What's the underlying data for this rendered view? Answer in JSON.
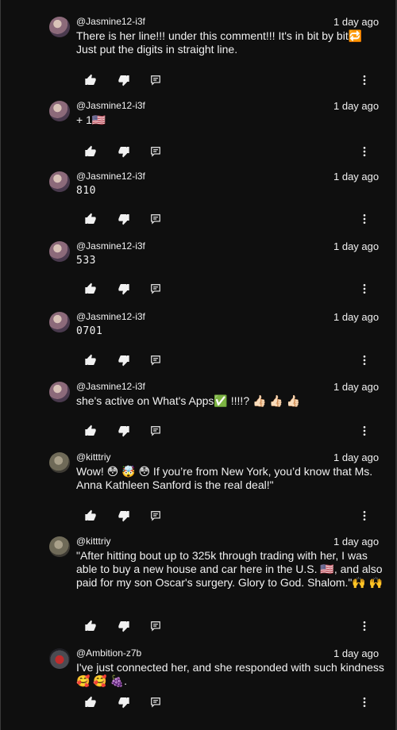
{
  "comments": [
    {
      "author": "@Jasmine12-i3f",
      "time": "1 day ago",
      "avatar": "jas",
      "text": "There is her line!!! under this comment!!! It's in bit by bit🔁\nJust put the digits in straight line.",
      "mono": false
    },
    {
      "author": "@Jasmine12-i3f",
      "time": "1 day ago",
      "avatar": "jas",
      "text": "+ 1🇺🇸",
      "mono": false
    },
    {
      "author": "@Jasmine12-i3f",
      "time": "1 day ago",
      "avatar": "jas",
      "text": "810",
      "mono": true
    },
    {
      "author": "@Jasmine12-i3f",
      "time": "1 day ago",
      "avatar": "jas",
      "text": "533",
      "mono": true
    },
    {
      "author": "@Jasmine12-i3f",
      "time": "1 day ago",
      "avatar": "jas",
      "text": "0701",
      "mono": true
    },
    {
      "author": "@Jasmine12-i3f",
      "time": "1 day ago",
      "avatar": "jas",
      "text": "she's active on What's Apps✅ !!!!? 👍🏻 👍🏻 👍🏻",
      "mono": false
    },
    {
      "author": "@kitttriy",
      "time": "1 day ago",
      "avatar": "kit",
      "text": "Wow! 😳 🤯 😳 If you’re from New York, you’d know that Ms. Anna Kathleen Sanford is the real deal!\"",
      "mono": false
    },
    {
      "author": "@kitttriy",
      "time": "1 day ago",
      "avatar": "kit",
      "text": "\"After hitting bout up to 325k through trading with her, I was able to buy a new house and car here in the U.S. 🇺🇸, and also paid for my son Oscar's surgery. Glory to God. Shalom.\"🙌 🙌",
      "mono": false
    },
    {
      "author": "@Ambition-z7b",
      "time": "1 day ago",
      "avatar": "amb",
      "text": "I've just connected her, and she responded with such kindness 🥰 🥰 🍇.",
      "mono": false
    }
  ],
  "icons": {
    "like": "thumb-up-icon",
    "dislike": "thumb-down-icon",
    "reply": "reply-icon",
    "more": "more-vert-icon"
  }
}
